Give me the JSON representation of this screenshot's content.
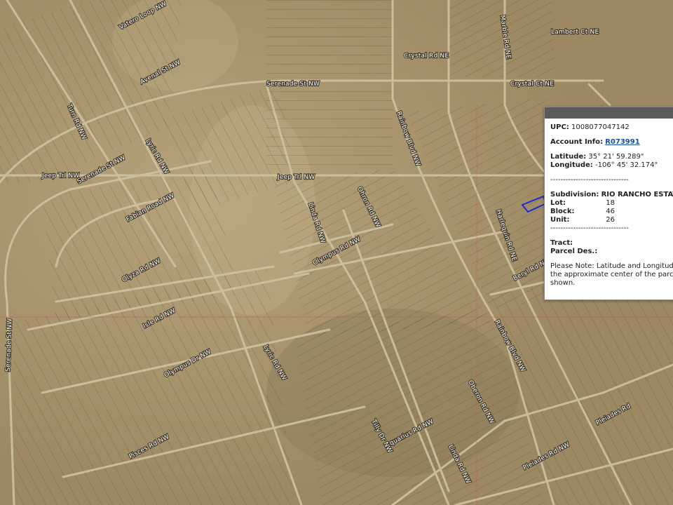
{
  "map": {
    "street_labels": [
      {
        "text": "Vatero Loop NW"
      },
      {
        "text": "Avenal St NW"
      },
      {
        "text": "Serenade St NW"
      },
      {
        "text": "Crystal Rd NE"
      },
      {
        "text": "Crystal Ct NE"
      },
      {
        "text": "Lambert Ct NE"
      },
      {
        "text": "Marble Rd NE"
      },
      {
        "text": "Rainbow Blvd NW"
      },
      {
        "text": "Jeep Trl NW"
      },
      {
        "text": "Jeep Trl NW"
      },
      {
        "text": "Lyric Rd NW"
      },
      {
        "text": "Serenade St NW"
      },
      {
        "text": "Fabian Road NW"
      },
      {
        "text": "Ohron Rd NW"
      },
      {
        "text": "Linda Rd NW"
      },
      {
        "text": "Olympus Rd NW"
      },
      {
        "text": "Olyza Rd NW"
      },
      {
        "text": "Isle Rd NW"
      },
      {
        "text": "Olympus Dr NW"
      },
      {
        "text": "Lyric Rd NW"
      },
      {
        "text": "Rainbow Blvd NW"
      },
      {
        "text": "Oberon Rd NW"
      },
      {
        "text": "Aquarius Rd NW"
      },
      {
        "text": "Tilly Dr NW"
      },
      {
        "text": "Linda Rd NW"
      },
      {
        "text": "Pisces Rd NW"
      },
      {
        "text": "Pleiades Rd NW"
      },
      {
        "text": "Pleiades Rd"
      },
      {
        "text": "Harlequin Rd NE"
      },
      {
        "text": "Beryl Rd NE"
      },
      {
        "text": "Serenade St NW"
      },
      {
        "text": "Turn Rd NW"
      }
    ],
    "parcel_outline_color": "#1c2bd6"
  },
  "popup": {
    "upc_label": "UPC:",
    "upc_value": "1008077047142",
    "account_label": "Account Info:",
    "account_link": "R073991",
    "latitude_label": "Latitude:",
    "latitude_value": "35° 21' 59.289\"",
    "longitude_label": "Longitude:",
    "longitude_value": "-106° 45' 32.174\"",
    "divider": "-------------------------------",
    "subdivision_label": "Subdivision:",
    "subdivision_value": "RIO RANCHO ESTATES",
    "lot_label": "Lot:",
    "lot_value": "18",
    "block_label": "Block:",
    "block_value": "46",
    "unit_label": "Unit:",
    "unit_value": "26",
    "tract_label": "Tract:",
    "parcel_des_label": "Parcel Des.:",
    "note": "Please Note: Latitude and Longitude the approximate center of the parcel shown."
  }
}
